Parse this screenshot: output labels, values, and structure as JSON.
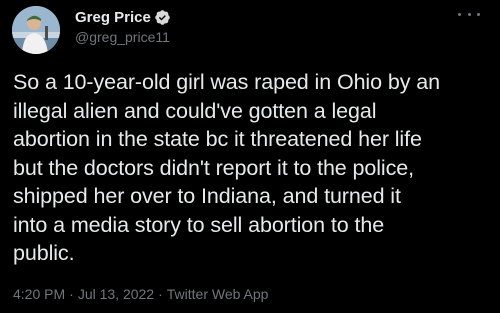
{
  "user": {
    "display_name": "Greg Price",
    "handle": "@greg_price11",
    "verified_icon": "verified-badge-icon",
    "verified_color": "#d9d9d9"
  },
  "tweet": {
    "text": "So a 10-year-old girl was raped in Ohio by an\nillegal alien and could've gotten a legal\nabortion in the state bc it threatened her life\nbut the doctors didn't report it to the police,\nshipped her over to Indiana, and turned it\ninto a media story to sell abortion to the\npublic.",
    "time": "4:20 PM",
    "date": "Jul 13, 2022",
    "separator": "·",
    "client": "Twitter Web App"
  },
  "menu": {
    "icon": "more-icon"
  },
  "colors": {
    "background": "#000000",
    "primary_text": "#e7e9ea",
    "secondary_text": "#71767b"
  }
}
